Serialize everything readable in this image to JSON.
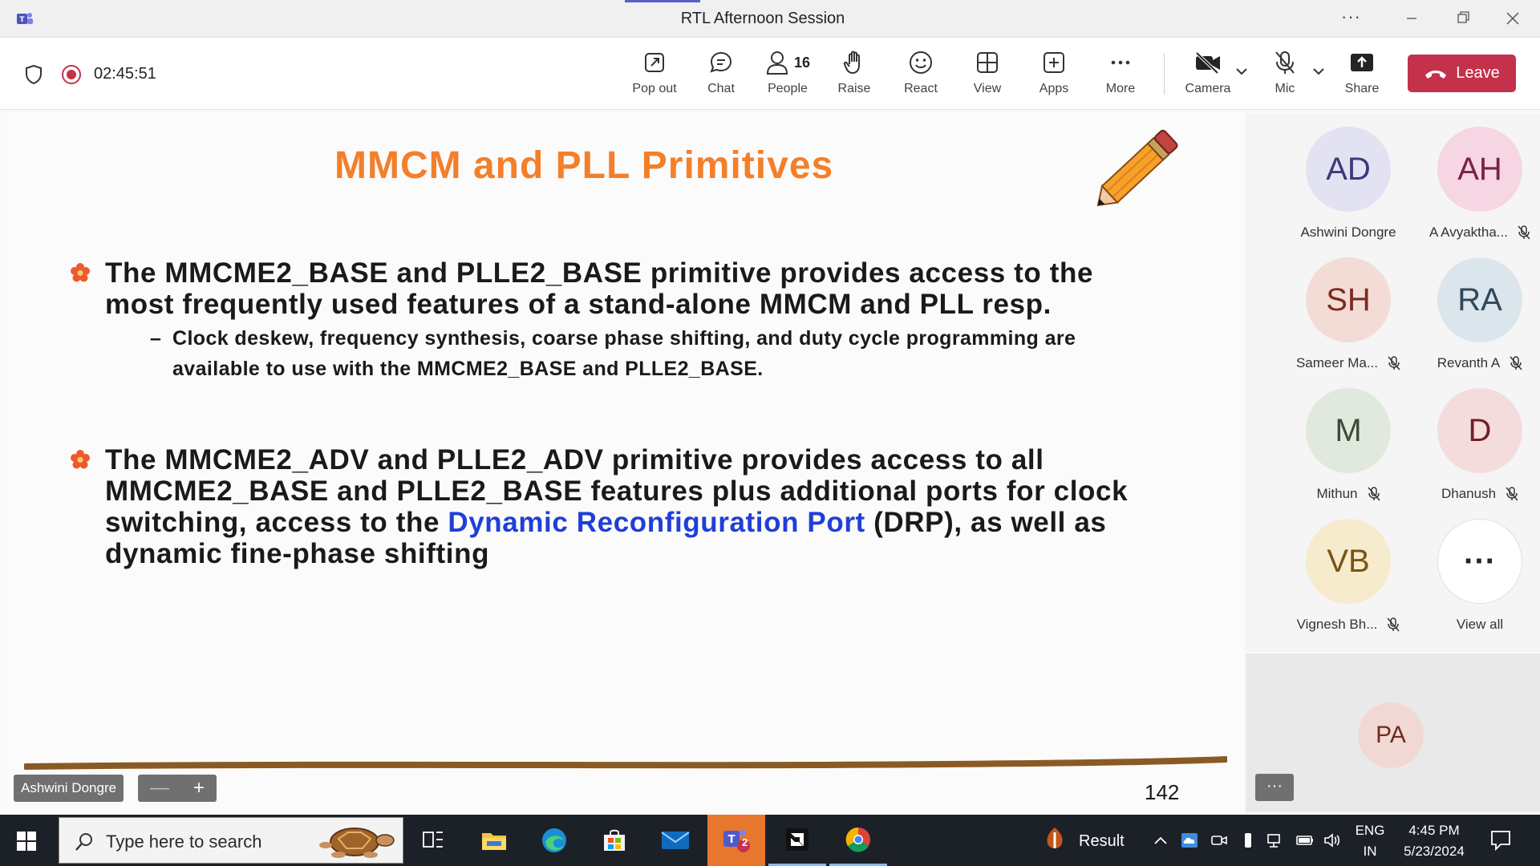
{
  "window": {
    "title": "RTL Afternoon Session"
  },
  "toolbar": {
    "timer": "02:45:51",
    "buttons": [
      {
        "label": "Pop out",
        "icon": "pop-out-icon"
      },
      {
        "label": "Chat",
        "icon": "chat-icon"
      },
      {
        "label": "People",
        "icon": "people-icon",
        "count": "16"
      },
      {
        "label": "Raise",
        "icon": "raise-hand-icon"
      },
      {
        "label": "React",
        "icon": "react-icon"
      },
      {
        "label": "View",
        "icon": "view-icon"
      },
      {
        "label": "Apps",
        "icon": "apps-icon"
      },
      {
        "label": "More",
        "icon": "more-icon"
      },
      {
        "label": "Camera",
        "icon": "camera-off-icon"
      },
      {
        "label": "Mic",
        "icon": "mic-off-icon"
      },
      {
        "label": "Share",
        "icon": "share-icon"
      }
    ],
    "leave_label": "Leave"
  },
  "slide": {
    "title": "MMCM and PLL Primitives",
    "bullet1": {
      "line1": "The MMCME2_BASE  and PLLE2_BASE  primitive provides access to the",
      "line2": "most frequently used features of a stand-alone MMCM and PLL resp.",
      "sub_dash": "–",
      "sub_line1": "Clock deskew, frequency synthesis, coarse phase shifting, and duty cycle programming are",
      "sub_line2": "available to use with the MMCME2_BASE and PLLE2_BASE."
    },
    "bullet2": {
      "line1": "The MMCME2_ADV and PLLE2_ADV primitive provides access to all",
      "line2": "MMCME2_BASE  and PLLE2_BASE features plus additional ports for clock",
      "line3_pre": "switching, access to the ",
      "line3_link": "Dynamic Reconfiguration Port",
      "line3_post": " (DRP), as well as",
      "line4": "dynamic fine-phase shifting"
    },
    "slide_number": "142",
    "presenter_name": "Ashwini Dongre",
    "zoom_minus": "—",
    "zoom_plus": "+"
  },
  "participants": [
    {
      "initials": "AD",
      "name": "Ashwini Dongre",
      "muted": false,
      "bg": "#e3e2f2",
      "fg": "#3b3a7a"
    },
    {
      "initials": "AH",
      "name": "A Avyaktha...",
      "muted": true,
      "bg": "#f6d6e3",
      "fg": "#7a2146"
    },
    {
      "initials": "SH",
      "name": "Sameer Ma...",
      "muted": true,
      "bg": "#f4dcd6",
      "fg": "#7a2b1f"
    },
    {
      "initials": "RA",
      "name": "Revanth A",
      "muted": true,
      "bg": "#dbe5ec",
      "fg": "#30485c"
    },
    {
      "initials": "M",
      "name": "Mithun",
      "muted": true,
      "bg": "#e1e8de",
      "fg": "#3c4b35"
    },
    {
      "initials": "D",
      "name": "Dhanush",
      "muted": true,
      "bg": "#f4dcdc",
      "fg": "#6f1f24"
    },
    {
      "initials": "VB",
      "name": "Vignesh Bh...",
      "muted": true,
      "bg": "#f6ebcd",
      "fg": "#7a5410"
    },
    {
      "initials": "···",
      "name": "View all",
      "muted": false,
      "bg": "#ffffff",
      "fg": "#242424"
    }
  ],
  "pinned": {
    "initials": "PA",
    "more": "···"
  },
  "taskbar": {
    "search_placeholder": "Type here to search",
    "teams_badge": "2",
    "result_label": "Result",
    "lang_line1": "ENG",
    "lang_line2": "IN",
    "time": "4:45 PM",
    "date": "5/23/2024"
  },
  "colors": {
    "accent": "#5b5fc7",
    "leave": "#c4314b",
    "slide_title": "#f47f2a",
    "link": "#1f3fd8",
    "active_app": "#e8772e"
  }
}
